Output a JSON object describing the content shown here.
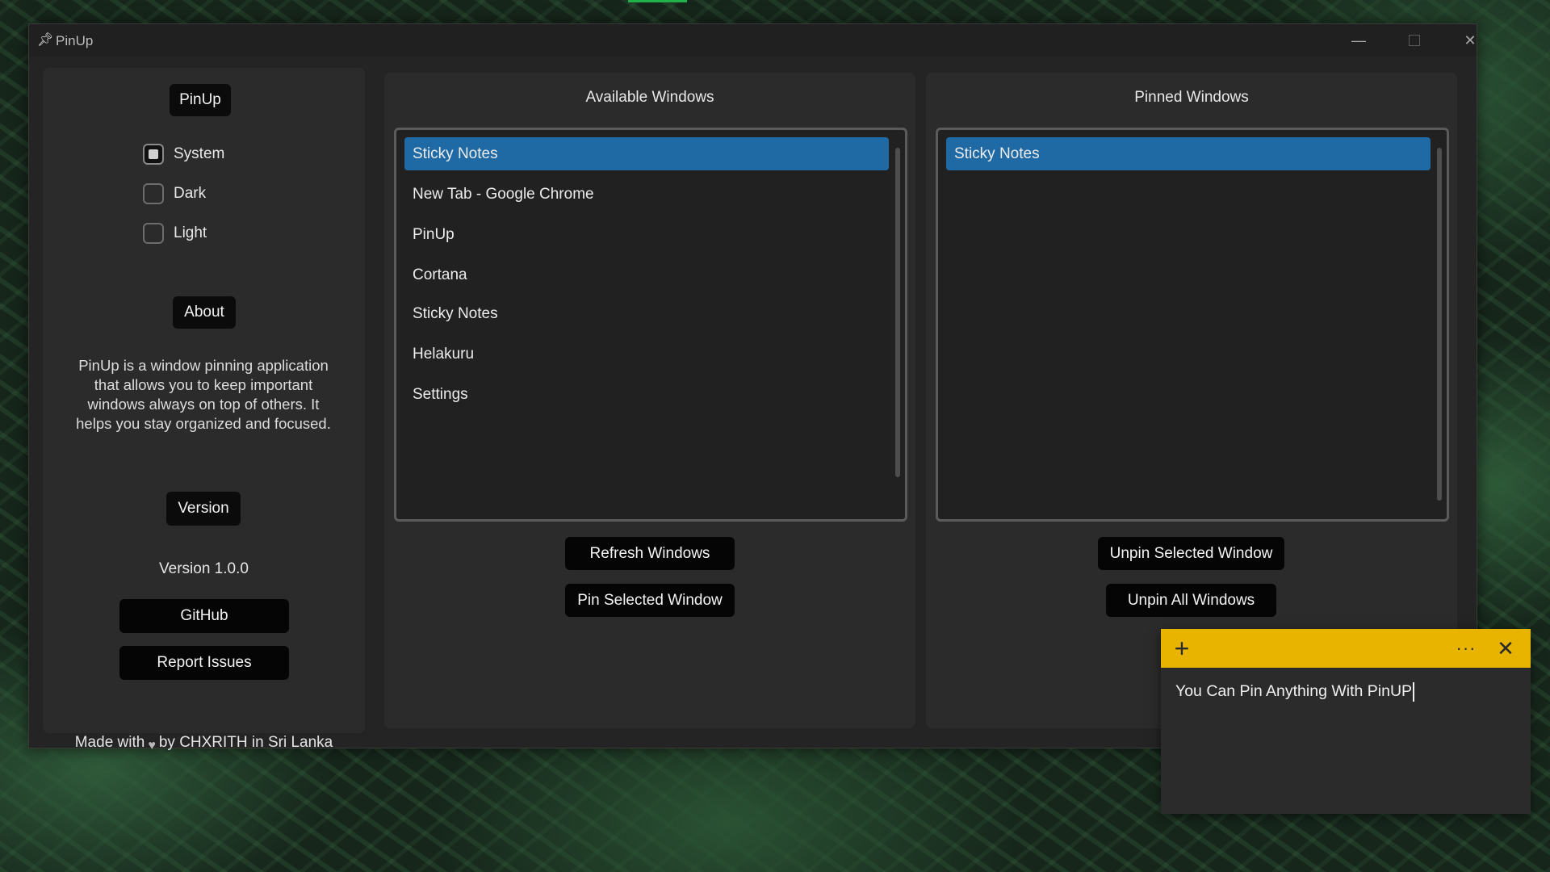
{
  "window": {
    "title": "PinUp",
    "controls": {
      "minimize": "—",
      "maximize": "",
      "close": "✕"
    }
  },
  "sidebar": {
    "header_badge": "PinUp",
    "theme_options": [
      {
        "label": "System",
        "selected": true
      },
      {
        "label": "Dark",
        "selected": false
      },
      {
        "label": "Light",
        "selected": false
      }
    ],
    "about_badge": "About",
    "about_text": "PinUp is a window pinning application that allows you to keep important windows always on top of others. It helps you stay organized and focused.",
    "version_badge": "Version",
    "version_text": "Version 1.0.0",
    "github_label": "GitHub",
    "report_label": "Report Issues",
    "made_prefix": "Made with",
    "made_suffix": "by CHXRITH in Sri Lanka",
    "heart_icon": "heart-icon"
  },
  "available": {
    "title": "Available Windows",
    "items": [
      "Sticky Notes",
      "New Tab - Google Chrome",
      "PinUp",
      "Cortana",
      "Sticky Notes",
      "Helakuru",
      "Settings"
    ],
    "selected_index": 0,
    "refresh_label": "Refresh Windows",
    "pin_label": "Pin Selected Window"
  },
  "pinned": {
    "title": "Pinned Windows",
    "items": [
      "Sticky Notes"
    ],
    "selected_index": 0,
    "unpin_label": "Unpin Selected Window",
    "unpin_all_label": "Unpin All Windows"
  },
  "sticky_note": {
    "text": "You Can Pin Anything With PinUP",
    "accent": "#e8b400"
  },
  "colors": {
    "selection": "#1f6aa5",
    "panel_bg": "#2b2b2b",
    "button_bg": "#050505"
  }
}
